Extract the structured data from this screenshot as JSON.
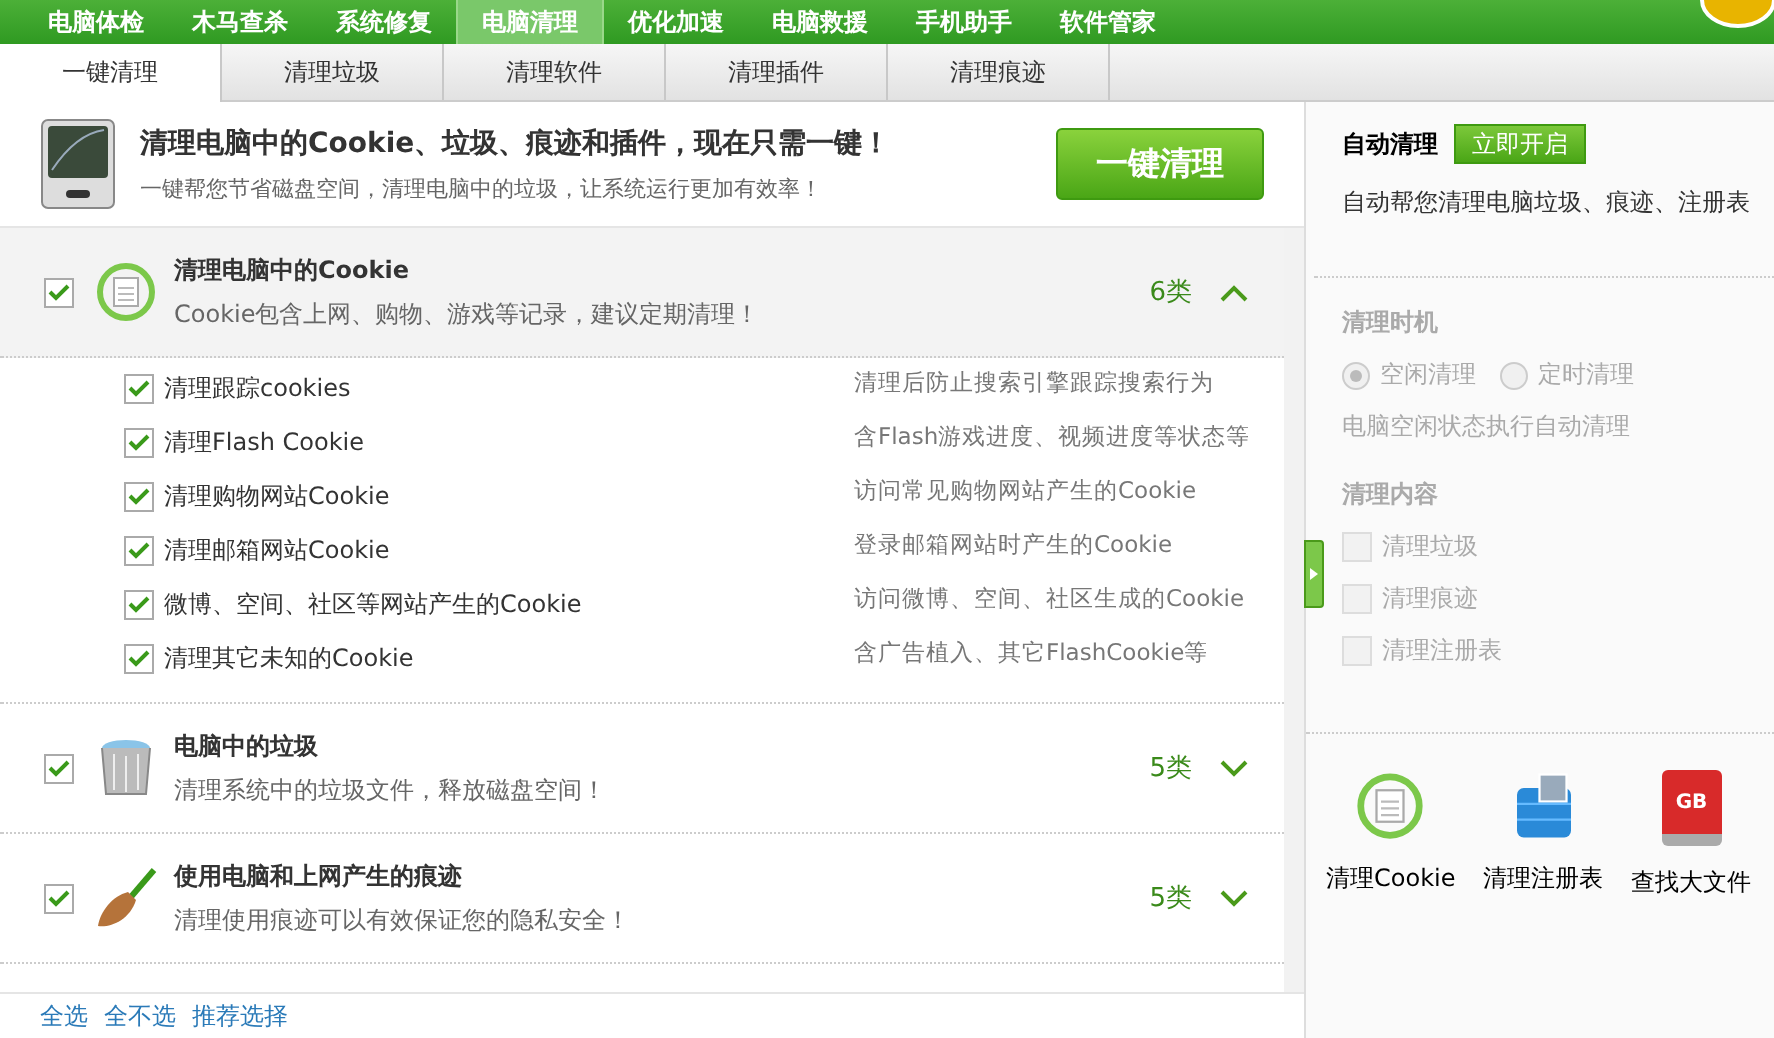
{
  "nav": [
    {
      "label": "电脑体检",
      "selected": false
    },
    {
      "label": "木马查杀",
      "selected": false
    },
    {
      "label": "系统修复",
      "selected": false
    },
    {
      "label": "电脑清理",
      "selected": true
    },
    {
      "label": "优化加速",
      "selected": false
    },
    {
      "label": "电脑救援",
      "selected": false
    },
    {
      "label": "手机助手",
      "selected": false
    },
    {
      "label": "软件管家",
      "selected": false
    }
  ],
  "tabs": [
    {
      "label": "一键清理",
      "selected": true
    },
    {
      "label": "清理垃圾",
      "selected": false
    },
    {
      "label": "清理软件",
      "selected": false
    },
    {
      "label": "清理插件",
      "selected": false
    },
    {
      "label": "清理痕迹",
      "selected": false
    }
  ],
  "header": {
    "title": "清理电脑中的Cookie、垃圾、痕迹和插件，现在只需一键！",
    "subtitle": "一键帮您节省磁盘空间，清理电脑中的垃圾，让系统运行更加有效率！",
    "button": "一键清理"
  },
  "groups": [
    {
      "kind": "cookie",
      "title": "清理电脑中的Cookie",
      "desc": "Cookie包含上网、购物、游戏等记录，建议定期清理！",
      "count": "6类",
      "checked": true,
      "expanded": true,
      "items": [
        {
          "label": "清理跟踪cookies",
          "note": "清理后防止搜索引擎跟踪搜索行为",
          "checked": true
        },
        {
          "label": "清理Flash Cookie",
          "note": "含Flash游戏进度、视频进度等状态等",
          "checked": true
        },
        {
          "label": "清理购物网站Cookie",
          "note": "访问常见购物网站产生的Cookie",
          "checked": true
        },
        {
          "label": "清理邮箱网站Cookie",
          "note": "登录邮箱网站时产生的Cookie",
          "checked": true
        },
        {
          "label": "微博、空间、社区等网站产生的Cookie",
          "note": "访问微博、空间、社区生成的Cookie",
          "checked": true
        },
        {
          "label": "清理其它未知的Cookie",
          "note": "含广告植入、其它FlashCookie等",
          "checked": true
        }
      ]
    },
    {
      "kind": "trash",
      "title": "电脑中的垃圾",
      "desc": "清理系统中的垃圾文件，释放磁盘空间！",
      "count": "5类",
      "checked": true,
      "expanded": false
    },
    {
      "kind": "broom",
      "title": "使用电脑和上网产生的痕迹",
      "desc": "清理使用痕迹可以有效保证您的隐私安全！",
      "count": "5类",
      "checked": true,
      "expanded": false
    }
  ],
  "footer_links": [
    "全选",
    "全不选",
    "推荐选择"
  ],
  "auto": {
    "title": "自动清理",
    "button": "立即开启",
    "desc": "自动帮您清理电脑垃圾、痕迹、注册表",
    "disabled": true,
    "timing_title": "清理时机",
    "timing": [
      {
        "label": "空闲清理",
        "selected": true
      },
      {
        "label": "定时清理",
        "selected": false
      }
    ],
    "timing_note": "电脑空闲状态执行自动清理",
    "content_title": "清理内容",
    "content": [
      {
        "label": "清理垃圾",
        "checked": false
      },
      {
        "label": "清理痕迹",
        "checked": false
      },
      {
        "label": "清理注册表",
        "checked": false
      }
    ]
  },
  "tools": [
    {
      "kind": "cookie",
      "label": "清理Cookie"
    },
    {
      "kind": "registry",
      "label": "清理注册表"
    },
    {
      "kind": "bigfile",
      "label": "查找大文件",
      "badge": "GB"
    }
  ]
}
